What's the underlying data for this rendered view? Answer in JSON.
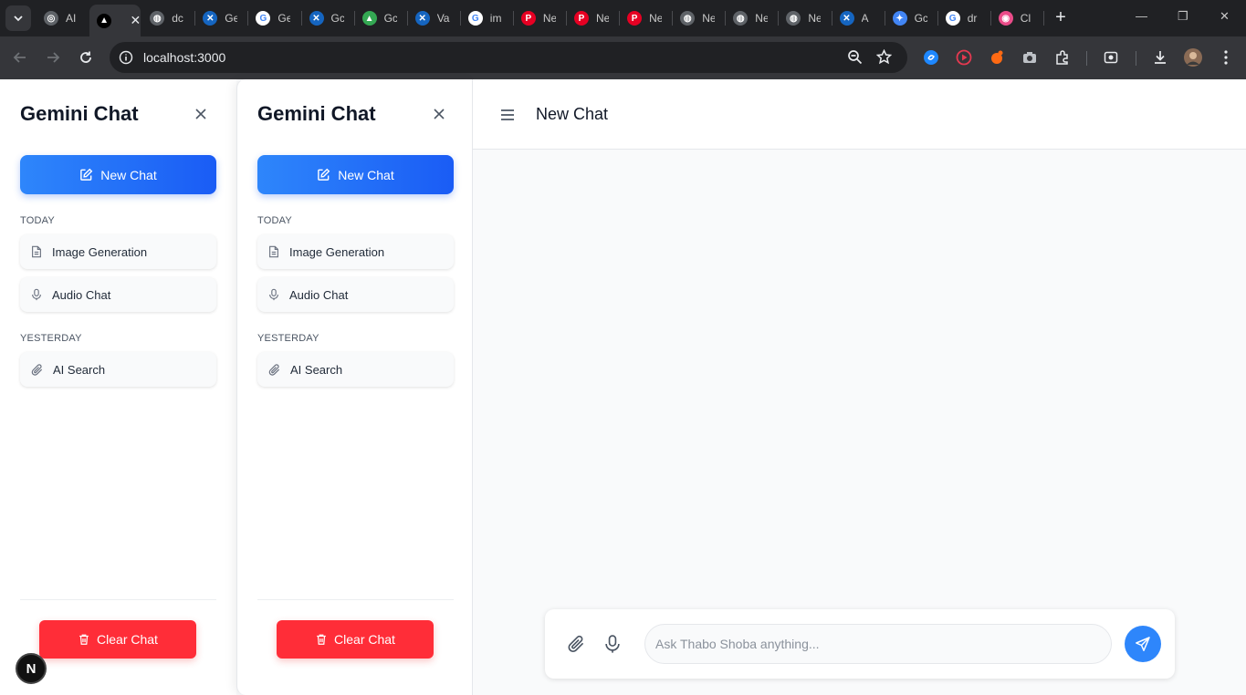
{
  "browser": {
    "tabs": [
      {
        "title": "AI",
        "color": "#5f6368",
        "letter": "◎"
      },
      {
        "title": "",
        "color": "#000000",
        "letter": "▲",
        "active": true
      },
      {
        "title": "dc",
        "color": "#5f6368",
        "letter": "◍"
      },
      {
        "title": "Ge",
        "color": "#1565c0",
        "letter": "✕"
      },
      {
        "title": "Ge",
        "color": "#ffffff",
        "letter": "G"
      },
      {
        "title": "Gc",
        "color": "#1565c0",
        "letter": "✕"
      },
      {
        "title": "Gc",
        "color": "#34a853",
        "letter": "▲"
      },
      {
        "title": "Va",
        "color": "#1565c0",
        "letter": "✕"
      },
      {
        "title": "im",
        "color": "#ffffff",
        "letter": "G"
      },
      {
        "title": "Ne",
        "color": "#e60023",
        "letter": "P"
      },
      {
        "title": "Ne",
        "color": "#e60023",
        "letter": "P"
      },
      {
        "title": "Ne",
        "color": "#e60023",
        "letter": "P"
      },
      {
        "title": "Ne",
        "color": "#5f6368",
        "letter": "◍"
      },
      {
        "title": "Ne",
        "color": "#5f6368",
        "letter": "◍"
      },
      {
        "title": "Ne",
        "color": "#5f6368",
        "letter": "◍"
      },
      {
        "title": "A",
        "color": "#1565c0",
        "letter": "✕"
      },
      {
        "title": "Gc",
        "color": "#4285f4",
        "letter": "✦"
      },
      {
        "title": "dr",
        "color": "#ffffff",
        "letter": "G"
      },
      {
        "title": "Cl",
        "color": "#ea4c89",
        "letter": "◉"
      }
    ],
    "url": "localhost:3000"
  },
  "sidebar": {
    "title": "Gemini Chat",
    "new_chat_label": "New Chat",
    "groups": [
      {
        "label": "TODAY",
        "items": [
          {
            "label": "Image Generation",
            "icon": "document-icon"
          },
          {
            "label": "Audio Chat",
            "icon": "microphone-icon"
          }
        ]
      },
      {
        "label": "YESTERDAY",
        "items": [
          {
            "label": "AI Search",
            "icon": "paperclip-icon"
          }
        ]
      }
    ],
    "clear_chat_label": "Clear Chat"
  },
  "main": {
    "title": "New Chat",
    "input_placeholder": "Ask Thabo Shoba anything..."
  },
  "colors": {
    "accent_blue": "#2e86fb",
    "danger_red": "#ff2d38"
  },
  "nextjs_badge": "N"
}
